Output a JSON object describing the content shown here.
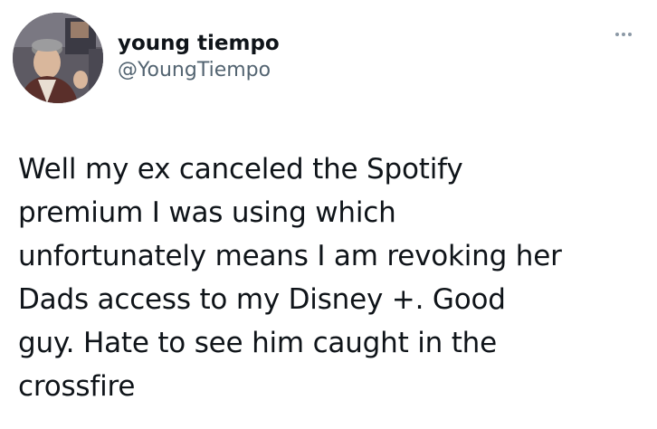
{
  "tweet": {
    "author": {
      "display_name": "young tiempo",
      "handle": "@YoungTiempo",
      "avatar": "profile-photo"
    },
    "more_icon": "ellipsis-icon",
    "text": "Well my ex canceled the Spotify\npremium I was using which\nunfortunately means I am revoking her\nDads access to my Disney +.  Good\nguy. Hate to see him caught in the\ncrossfire"
  }
}
